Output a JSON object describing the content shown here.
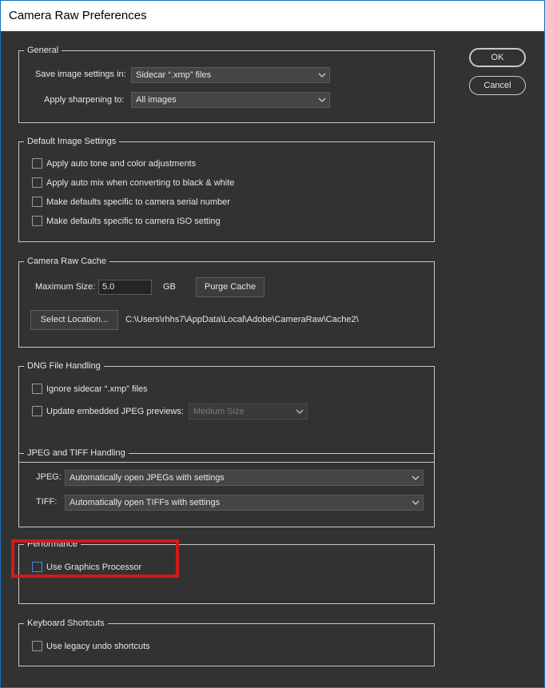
{
  "window": {
    "title": "Camera Raw Preferences"
  },
  "buttons": {
    "ok": "OK",
    "cancel": "Cancel"
  },
  "general": {
    "legend": "General",
    "save_settings_label": "Save image settings in:",
    "save_settings_value": "Sidecar “.xmp” files",
    "sharpening_label": "Apply sharpening to:",
    "sharpening_value": "All images"
  },
  "default_image_settings": {
    "legend": "Default Image Settings",
    "options": [
      {
        "label": "Apply auto tone and color adjustments",
        "checked": false
      },
      {
        "label": "Apply auto mix when converting to black & white",
        "checked": false
      },
      {
        "label": "Make defaults specific to camera serial number",
        "checked": false
      },
      {
        "label": "Make defaults specific to camera ISO setting",
        "checked": false
      }
    ]
  },
  "cache": {
    "legend": "Camera Raw Cache",
    "max_size_label": "Maximum Size:",
    "max_size_value": "5.0",
    "unit": "GB",
    "purge_label": "Purge Cache",
    "select_location_label": "Select Location...",
    "location_path": "C:\\Users\\rhhs7\\AppData\\Local\\Adobe\\CameraRaw\\Cache2\\"
  },
  "dng": {
    "legend": "DNG File Handling",
    "ignore_sidecar_label": "Ignore sidecar “.xmp” files",
    "ignore_sidecar_checked": false,
    "update_previews_label": "Update embedded JPEG previews:",
    "update_previews_checked": false,
    "preview_size_value": "Medium Size"
  },
  "jpeg_tiff": {
    "legend": "JPEG and TIFF Handling",
    "jpeg_label": "JPEG:",
    "jpeg_value": "Automatically open JPEGs with settings",
    "tiff_label": "TIFF:",
    "tiff_value": "Automatically open TIFFs with settings"
  },
  "performance": {
    "legend": "Performance",
    "gpu_label": "Use Graphics Processor",
    "gpu_checked": false
  },
  "keyboard": {
    "legend": "Keyboard Shortcuts",
    "legacy_undo_label": "Use legacy undo shortcuts",
    "legacy_undo_checked": false
  },
  "colors": {
    "dialog_bg": "#323232",
    "frame": "#c8c8c8",
    "text": "#e6e6e6",
    "annotation_red": "#d21a1a"
  }
}
